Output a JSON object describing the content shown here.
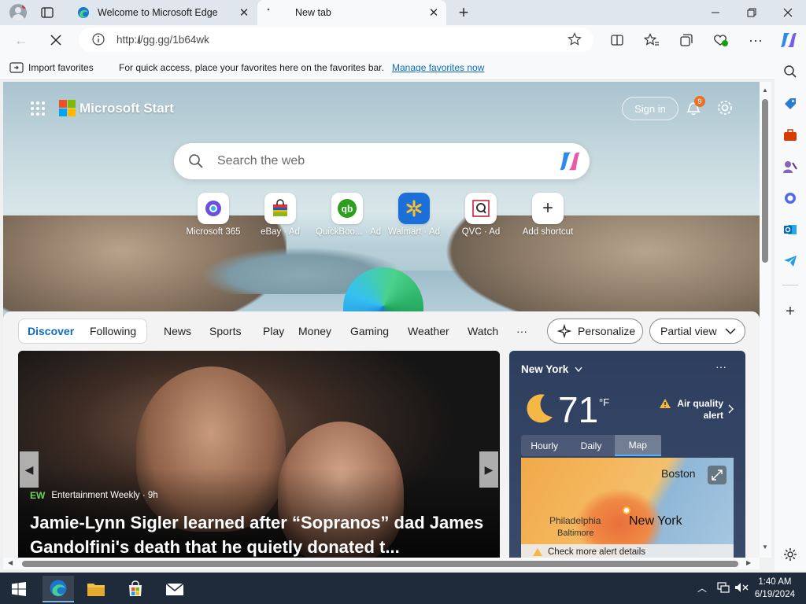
{
  "browser": {
    "tabs": [
      {
        "title": "Welcome to Microsoft Edge",
        "active": false
      },
      {
        "title": "New tab",
        "active": true
      }
    ],
    "url": "http://gg.gg/1b64wk",
    "favorites_bar": {
      "import_label": "Import favorites",
      "message": "For quick access, place your favorites here on the favorites bar.",
      "manage_link": "Manage favorites now"
    }
  },
  "newtab": {
    "brand": "Microsoft Start",
    "sign_in": "Sign in",
    "notification_count": "9",
    "search_placeholder": "Search the web",
    "shortcuts": [
      {
        "label": "Microsoft 365",
        "icon": "microsoft-365-icon"
      },
      {
        "label": "eBay · Ad",
        "icon": "ebay-bag-icon"
      },
      {
        "label": "QuickBoo... · Ad",
        "icon": "quickbooks-icon"
      },
      {
        "label": "Walmart · Ad",
        "icon": "walmart-spark-icon"
      },
      {
        "label": "QVC · Ad",
        "icon": "qvc-icon"
      },
      {
        "label": "Add shortcut",
        "icon": "plus-icon"
      }
    ],
    "feed_tabs": [
      "Discover",
      "Following",
      "News",
      "Sports",
      "Play",
      "Money",
      "Gaming",
      "Weather",
      "Watch",
      "···"
    ],
    "personalize": "Personalize",
    "view_mode": "Partial view"
  },
  "hero_story": {
    "source_badge": "EW",
    "source": "Entertainment Weekly · 9h",
    "headline": "Jamie-Lynn Sigler learned after “Sopranos” dad James Gandolfini's death that he quietly donated t..."
  },
  "weather": {
    "location": "New York",
    "temperature": "71",
    "unit": "°F",
    "alert": "Air quality alert",
    "tabs": [
      "Hourly",
      "Daily",
      "Map"
    ],
    "active_tab": "Map",
    "map_labels": {
      "boston": "Boston",
      "new_york": "New York",
      "philadelphia": "Philadelphia",
      "baltimore": "Baltimore"
    },
    "alert_details": "Check more alert details"
  },
  "taskbar": {
    "time": "1:40 AM",
    "date": "6/19/2024"
  },
  "colors": {
    "accent": "#0f6cbd",
    "taskbar": "#1f2a3a"
  }
}
